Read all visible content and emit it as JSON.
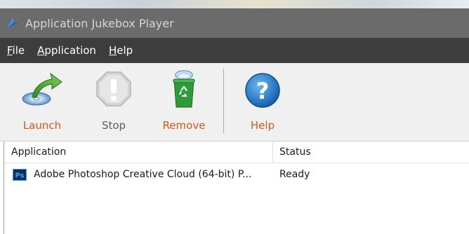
{
  "window": {
    "title": "Application Jukebox Player"
  },
  "menu": [
    {
      "label": "File",
      "accel": "F",
      "rest": "ile"
    },
    {
      "label": "Application",
      "accel": "A",
      "rest": "pplication"
    },
    {
      "label": "Help",
      "accel": "H",
      "rest": "elp"
    }
  ],
  "toolbar": {
    "launch_label": "Launch",
    "stop_label": "Stop",
    "remove_label": "Remove",
    "help_label": "Help"
  },
  "list": {
    "columns": [
      "Application",
      "Status"
    ],
    "rows": [
      {
        "icon": "photoshop-icon",
        "icon_text": "Ps",
        "application": "Adobe Photoshop Creative Cloud (64-bit) P...",
        "status": "Ready"
      }
    ]
  },
  "colors": {
    "titlebar": "#6b6b6b",
    "menubar": "#3d3d3d",
    "toolbar": "#f0f0f0",
    "label_orange": "#d25a1b",
    "photoshop_blue": "#0f2d5a"
  }
}
